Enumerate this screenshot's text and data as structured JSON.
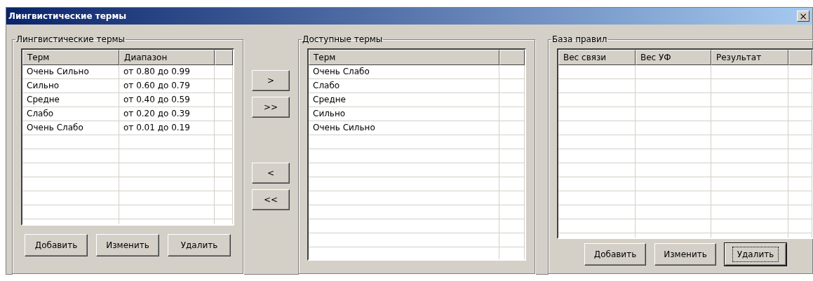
{
  "window": {
    "title": "Лингвистические термы",
    "close": "×"
  },
  "linguistic_terms": {
    "title": "Лингвистические термы",
    "table": {
      "columns": [
        "Терм",
        "Диапазон"
      ],
      "rows": [
        [
          "Очень Сильно",
          "от 0.80 до 0.99"
        ],
        [
          "Сильно",
          "от 0.60 до 0.79"
        ],
        [
          "Средне",
          "от 0.40 до 0.59"
        ],
        [
          "Слабо",
          "от 0.20 до 0.39"
        ],
        [
          "Очень Слабо",
          "от 0.01 до 0.19"
        ]
      ]
    },
    "buttons": [
      {
        "label": "Добавить",
        "focused": false
      },
      {
        "label": "Изменить",
        "focused": false
      },
      {
        "label": "Удалить",
        "focused": false
      }
    ]
  },
  "transfer_buttons": [
    ">",
    ">>",
    "<",
    "<<"
  ],
  "available_terms": {
    "title": "Доступные термы",
    "table": {
      "columns": [
        "Терм"
      ],
      "rows": [
        [
          "Очень Слабо"
        ],
        [
          "Слабо"
        ],
        [
          "Средне"
        ],
        [
          "Сильно"
        ],
        [
          "Очень Сильно"
        ]
      ]
    }
  },
  "rule_base": {
    "title": "База правил",
    "table": {
      "columns": [
        "Вес связи",
        "Вес УФ",
        "Результат"
      ]
    },
    "buttons": [
      {
        "label": "Добавить",
        "focused": false
      },
      {
        "label": "Изменить",
        "focused": false
      },
      {
        "label": "Удалить",
        "focused": true
      }
    ]
  }
}
